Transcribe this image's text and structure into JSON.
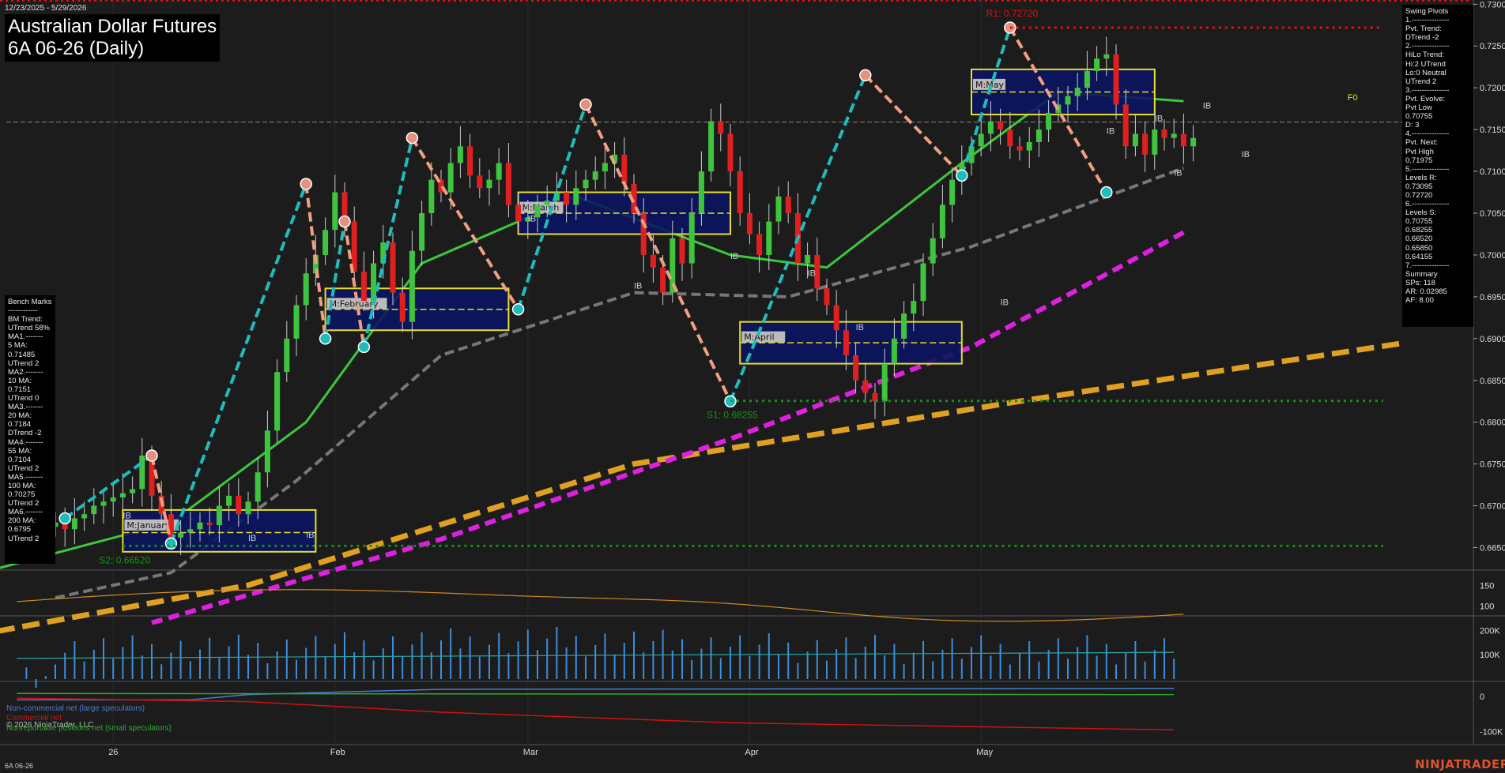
{
  "header": {
    "date_range": "12/23/2025 - 5/29/2026",
    "title": "Australian Dollar Futures",
    "subtitle": "6A 06-26 (Daily)"
  },
  "footer": {
    "symbol": "6A 06-26",
    "brand": "NINJATRADER",
    "copyright": "© 2026 NinjaTrader, LLC"
  },
  "swing_panel": {
    "lines": [
      "Swing Pivots",
      "1.---------------",
      "Pvt. Trend:",
      "DTrend -2",
      "2.---------------",
      "HiLo Trend:",
      "Hi:2 UTrend",
      "Lo:0 Neutral",
      "UTrend 2",
      "3.---------------",
      "Pvt. Evolve:",
      "Pvt Low",
      "0.70755",
      "D: 3",
      "4.---------------",
      "Pvt. Next:",
      "Pvt High",
      "0.71975",
      "5.---------------",
      "Levels R:",
      "0.73095",
      "0.72720",
      "6.---------------",
      "Levels S:",
      "0.70755",
      "0.68255",
      "0.66520",
      "0.65850",
      "0.64155",
      "7.---------------",
      "Summary",
      "SPs: 118",
      "AR: 0.02985",
      "AF: 8.00"
    ]
  },
  "bench_panel": {
    "lines": [
      "Bench Marks",
      "------------",
      "BM Trend:",
      "UTrend 58%",
      "MA1.-------",
      "5 MA:",
      "0.71485",
      "UTrend 2",
      "MA2.-------",
      "10 MA:",
      "0.7151",
      "UTrend 0",
      "MA3.-------",
      "20 MA:",
      "0.7184",
      "DTrend -2",
      "MA4.-------",
      "55 MA:",
      "0.7104",
      "UTrend 2",
      "MA5.-------",
      "100 MA:",
      "0.70275",
      "UTrend 2",
      "MA6.-------",
      "200 MA:",
      "0.6795",
      "UTrend 2"
    ]
  },
  "cot_legend": [
    {
      "label": "Non-commercial net (large speculators)",
      "color": "#4a7bd0"
    },
    {
      "label": "Commercial net",
      "color": "#d01010"
    },
    {
      "label": "Nonreportable positions net (small speculators)",
      "color": "#2fa82f"
    }
  ],
  "colors": {
    "up_candle": "#3ec43e",
    "down_candle": "#e02020",
    "ma_fast": "#3cc83c",
    "ma_mid": "#2aa5a5",
    "ma_55": "#777777",
    "ma_100": "#e020e0",
    "ma_200": "#e0a020",
    "swing_up": "#1fbcbc",
    "swing_down": "#f0a080",
    "resistance": "#e01010",
    "support": "#189018"
  },
  "chart_data": {
    "type": "candlestick",
    "price_axis": {
      "ylim": [
        0.6625,
        0.7305
      ],
      "ticks": [
        0.665,
        0.67,
        0.675,
        0.68,
        0.685,
        0.69,
        0.695,
        0.7,
        0.705,
        0.71,
        0.715,
        0.72,
        0.725,
        0.73
      ],
      "tick_labels": [
        "0.66500",
        "0.67000",
        "0.67500",
        "0.68000",
        "0.68500",
        "0.69000",
        "0.69500",
        "0.70000",
        "0.70500",
        "0.71000",
        "0.71500",
        "0.72000",
        "0.72500",
        "0.73000"
      ]
    },
    "x_labels": [
      {
        "label": "26",
        "bar": 6
      },
      {
        "label": "Feb",
        "bar": 29
      },
      {
        "label": "Mar",
        "bar": 49
      },
      {
        "label": "Apr",
        "bar": 72
      },
      {
        "label": "May",
        "bar": 96
      }
    ],
    "bars_count": 119,
    "closes": [
      0.668,
      0.6672,
      0.6685,
      0.669,
      0.67,
      0.6705,
      0.671,
      0.6715,
      0.672,
      0.676,
      0.6712,
      0.669,
      0.6662,
      0.6668,
      0.6672,
      0.668,
      0.6677,
      0.67,
      0.6712,
      0.669,
      0.6705,
      0.674,
      0.679,
      0.686,
      0.69,
      0.694,
      0.6978,
      0.7,
      0.703,
      0.7075,
      0.704,
      0.698,
      0.6945,
      0.699,
      0.7015,
      0.6955,
      0.692,
      0.7005,
      0.705,
      0.709,
      0.7075,
      0.711,
      0.713,
      0.7095,
      0.708,
      0.709,
      0.711,
      0.706,
      0.704,
      0.7045,
      0.706,
      0.7065,
      0.7075,
      0.706,
      0.708,
      0.709,
      0.71,
      0.711,
      0.712,
      0.7085,
      0.705,
      0.7,
      0.6985,
      0.6955,
      0.702,
      0.699,
      0.705,
      0.71,
      0.716,
      0.7145,
      0.71,
      0.705,
      0.7025,
      0.7,
      0.704,
      0.707,
      0.705,
      0.699,
      0.7,
      0.696,
      0.694,
      0.691,
      0.688,
      0.685,
      0.6835,
      0.6825,
      0.687,
      0.69,
      0.693,
      0.6945,
      0.699,
      0.702,
      0.706,
      0.709,
      0.711,
      0.713,
      0.7145,
      0.716,
      0.715,
      0.713,
      0.7125,
      0.7135,
      0.715,
      0.717,
      0.718,
      0.719,
      0.72,
      0.722,
      0.7235,
      0.724,
      0.718,
      0.713,
      0.7145,
      0.712,
      0.715,
      0.714,
      0.7145,
      0.713,
      0.714
    ],
    "swing_points": [
      {
        "bar": 1,
        "price": 0.6685,
        "type": "low"
      },
      {
        "bar": 10,
        "price": 0.676,
        "type": "high"
      },
      {
        "bar": 12,
        "price": 0.6655,
        "type": "low"
      },
      {
        "bar": 26,
        "price": 0.7085,
        "type": "high"
      },
      {
        "bar": 28,
        "price": 0.69,
        "type": "low"
      },
      {
        "bar": 30,
        "price": 0.704,
        "type": "high"
      },
      {
        "bar": 32,
        "price": 0.689,
        "type": "low"
      },
      {
        "bar": 37,
        "price": 0.714,
        "type": "high"
      },
      {
        "bar": 48,
        "price": 0.6935,
        "type": "low"
      },
      {
        "bar": 55,
        "price": 0.718,
        "type": "high"
      },
      {
        "bar": 70,
        "price": 0.6825,
        "type": "low"
      },
      {
        "bar": 84,
        "price": 0.7215,
        "type": "high"
      },
      {
        "bar": 94,
        "price": 0.7095,
        "type": "low"
      },
      {
        "bar": 99,
        "price": 0.7272,
        "type": "high"
      },
      {
        "bar": 109,
        "price": 0.7075,
        "type": "low"
      }
    ],
    "monthly_boxes": [
      {
        "label": "M:January",
        "start": 7,
        "end": 27,
        "top": 0.6695,
        "bottom": 0.6645,
        "mid": 0.6668
      },
      {
        "label": "M:February",
        "start": 28,
        "end": 47,
        "top": 0.696,
        "bottom": 0.691,
        "mid": 0.6935
      },
      {
        "label": "M:March",
        "start": 48,
        "end": 70,
        "top": 0.7075,
        "bottom": 0.7025,
        "mid": 0.705
      },
      {
        "label": "M:April",
        "start": 71,
        "end": 94,
        "top": 0.692,
        "bottom": 0.687,
        "mid": 0.6895
      },
      {
        "label": "M:May",
        "start": 95,
        "end": 114,
        "top": 0.7222,
        "bottom": 0.7168,
        "mid": 0.7195
      }
    ],
    "levels": [
      {
        "label": "R1: 0.72720",
        "price": 0.7272,
        "color": "resistance",
        "start": 99
      },
      {
        "label": "S1: 0.68255",
        "price": 0.68255,
        "color": "support",
        "start": 70
      },
      {
        "label": "S2: 0.66520",
        "price": 0.6652,
        "color": "support",
        "start": 7
      }
    ],
    "level_labels": {
      "F0": "F0",
      "IB": "IB"
    },
    "ma_200_end": [
      0.6795
    ],
    "ma_100_end": [
      0.70275
    ],
    "ma_55_end": [
      0.7104
    ],
    "ma_20_end": [
      0.7184
    ],
    "adx_panel": {
      "ticks": [
        100,
        150
      ],
      "tick_labels": [
        "100",
        "150"
      ],
      "ylim": [
        80,
        180
      ]
    },
    "volume_panel": {
      "ticks": [
        100000,
        200000
      ],
      "tick_labels": [
        "100K",
        "200K"
      ],
      "ylim": [
        0,
        260000
      ]
    },
    "cot_panel": {
      "ticks": [
        0,
        -100000
      ],
      "tick_labels": [
        "0",
        "-100K"
      ],
      "ylim": [
        -130000,
        40000
      ]
    }
  }
}
